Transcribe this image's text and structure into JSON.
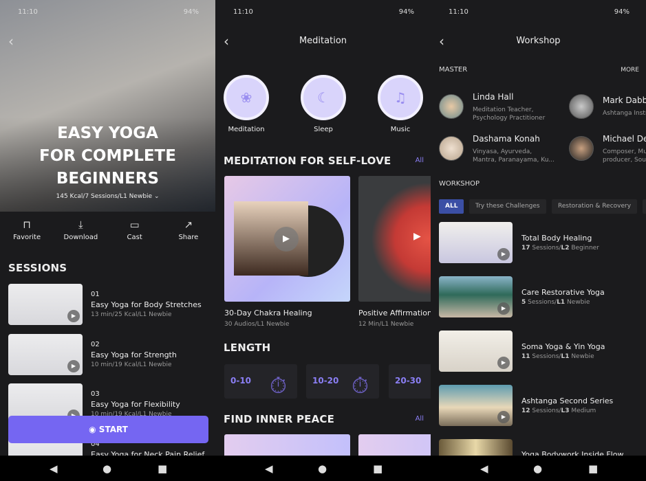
{
  "status": {
    "time": "11:10",
    "battery": "94%",
    "icons": "mute wifi signal battery"
  },
  "nav": {
    "back": "◀",
    "home": "●",
    "recent": "■"
  },
  "yoga": {
    "title_lines": [
      "EASY YOGA",
      "FOR COMPLETE",
      "BEGINNERS"
    ],
    "subtitle": "145 Kcal/7 Sessions/L1 Newbie",
    "actions": [
      {
        "label": "Favorite",
        "icon": "bookmark-icon"
      },
      {
        "label": "Download",
        "icon": "download-icon"
      },
      {
        "label": "Cast",
        "icon": "cast-icon"
      },
      {
        "label": "Share",
        "icon": "share-icon"
      }
    ],
    "sessions_title": "SESSIONS",
    "sessions": [
      {
        "num": "01",
        "title": "Easy Yoga for Body Stretches",
        "meta": "13 min/25 Kcal/L1 Newbie"
      },
      {
        "num": "02",
        "title": "Easy Yoga for Strength",
        "meta": "10 min/19 Kcal/L1 Newbie"
      },
      {
        "num": "03",
        "title": "Easy Yoga for Flexibility",
        "meta": "10 min/19 Kcal/L1 Newbie"
      },
      {
        "num": "04",
        "title": "Easy Yoga for Neck Pain Relief",
        "meta": ""
      }
    ],
    "start": "START",
    "accent": "#7566f2"
  },
  "meditation": {
    "header": "Meditation",
    "categories": [
      {
        "label": "Meditation",
        "icon": "lotus-icon"
      },
      {
        "label": "Sleep",
        "icon": "moon-icon"
      },
      {
        "label": "Music",
        "icon": "music-note-icon"
      }
    ],
    "section1": "MEDITATION FOR SELF-LOVE",
    "all": "All",
    "cards": [
      {
        "title": "30-Day Chakra Healing",
        "meta": "30 Audios/L1 Newbie"
      },
      {
        "title": "Positive Affirmation",
        "meta": "12 Min/L1 Newbie"
      }
    ],
    "length_title": "LENGTH",
    "lengths": [
      "0-10",
      "10-20",
      "20-30"
    ],
    "section2": "FIND INNER PEACE"
  },
  "workshop": {
    "header": "Workshop",
    "master_title": "MASTER",
    "more": "MORE",
    "masters": [
      {
        "name": "Linda Hall",
        "desc": [
          "Meditation Teacher,",
          "Psychology Practitioner"
        ]
      },
      {
        "name": "Dashama Konah",
        "desc": [
          "Vinyasa, Ayurveda,",
          "Mantra, Paranayama, Ku..."
        ]
      },
      {
        "name": "Mark Dabbs",
        "desc": [
          "Ashtanga Instructor",
          ""
        ]
      },
      {
        "name": "Michael Dean",
        "desc": [
          "Composer, Music",
          "producer, Sound"
        ]
      }
    ],
    "workshop_title": "WORKSHOP",
    "chips": [
      "ALL",
      "Try these Challenges",
      "Restoration & Recovery"
    ],
    "items": [
      {
        "title": "Total Body Healing",
        "count": "17",
        "unit": " Sessions/",
        "level": "L2",
        "level_name": " Beginner"
      },
      {
        "title": "Care Restorative Yoga",
        "count": "5",
        "unit": " Sessions/",
        "level": "L1",
        "level_name": " Newbie"
      },
      {
        "title": "Soma Yoga & Yin Yoga",
        "count": "11",
        "unit": " Sessions/",
        "level": "L1",
        "level_name": " Newbie"
      },
      {
        "title": "Ashtanga Second Series",
        "count": "12",
        "unit": " Sessions/",
        "level": "L3",
        "level_name": " Medium"
      },
      {
        "title": "Yoga Bodywork Inside Flow",
        "count": "",
        "unit": "",
        "level": "",
        "level_name": ""
      }
    ]
  }
}
